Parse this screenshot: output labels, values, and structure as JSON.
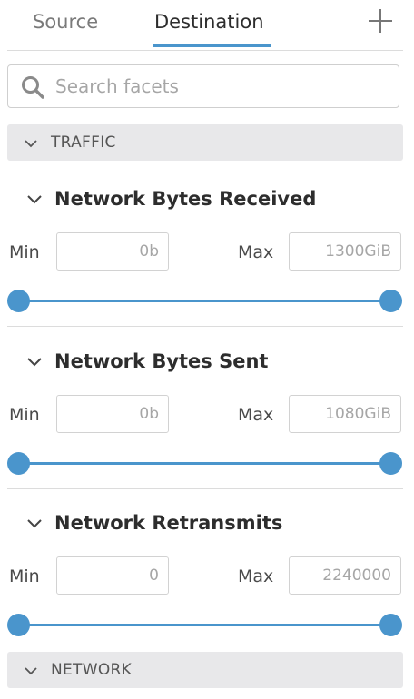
{
  "tabs": [
    {
      "label": "Source",
      "active": false
    },
    {
      "label": "Destination",
      "active": true
    }
  ],
  "add_tab_icon": "plus-icon",
  "search": {
    "icon": "search-icon",
    "placeholder": "Search facets",
    "value": ""
  },
  "groups": {
    "traffic": {
      "label": "TRAFFIC",
      "expanded": true
    },
    "network": {
      "label": "NETWORK",
      "expanded": false
    }
  },
  "facets": [
    {
      "title": "Network Bytes Received",
      "min_label": "Min",
      "max_label": "Max",
      "min_placeholder": "0b",
      "max_placeholder": "1300GiB",
      "min_value": "",
      "max_value": ""
    },
    {
      "title": "Network Bytes Sent",
      "min_label": "Min",
      "max_label": "Max",
      "min_placeholder": "0b",
      "max_placeholder": "1080GiB",
      "min_value": "",
      "max_value": ""
    },
    {
      "title": "Network Retransmits",
      "min_label": "Min",
      "max_label": "Max",
      "min_placeholder": "0",
      "max_placeholder": "2240000",
      "min_value": "",
      "max_value": ""
    }
  ],
  "colors": {
    "accent": "#4a95cc",
    "group_header_bg": "#e8e8ea",
    "divider": "#dcdcdc"
  }
}
